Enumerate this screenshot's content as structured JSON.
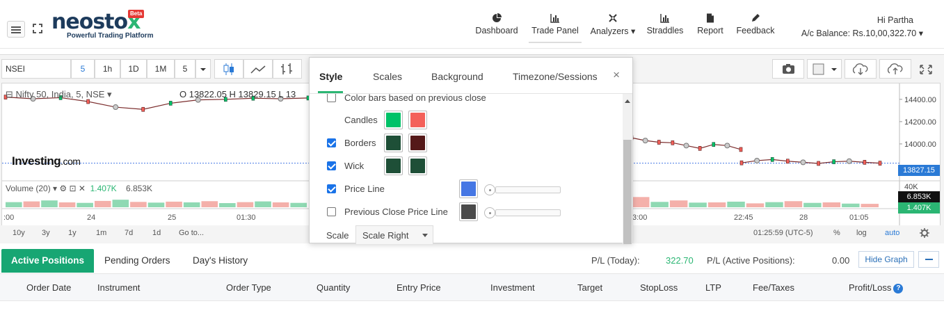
{
  "header": {
    "logo_text": "neosto",
    "logo_x": "x",
    "beta": "Beta",
    "tagline": "Powerful Trading Platform",
    "nav": [
      {
        "label": "Dashboard",
        "icon": "pie-chart-icon"
      },
      {
        "label": "Trade Panel",
        "icon": "bar-chart-icon"
      },
      {
        "label": "Analyzers",
        "icon": "tools-icon"
      },
      {
        "label": "Straddles",
        "icon": "bar-chart-icon"
      },
      {
        "label": "Report",
        "icon": "document-icon"
      },
      {
        "label": "Feedback",
        "icon": "pencil-icon"
      }
    ],
    "greeting": "Hi Partha",
    "balance": "A/c Balance: Rs.10,00,322.70"
  },
  "chart": {
    "symbol": "NSEI",
    "timeframes": [
      "5",
      "1h",
      "1D",
      "1M",
      "5"
    ],
    "legend": "Nifty 50, India, 5, NSE",
    "ohlc": "O 13822.05   H 13829.15   L 13",
    "watermark": "Investing",
    "watermark_suffix": ".com",
    "volume_label": "Volume (20)",
    "volume_1": "1.407K",
    "volume_2": "6.853K",
    "last_price": "13827.15",
    "vol_tag_1": "6.853K",
    "vol_tag_2": "1.407K",
    "bottom": [
      "10y",
      "3y",
      "1y",
      "1m",
      "7d",
      "1d",
      "Go to..."
    ],
    "clock": "01:25:59 (UTC-5)",
    "pct": "%",
    "log": "log",
    "auto": "auto"
  },
  "chart_data": {
    "type": "line",
    "title": "Nifty 50, India, 5, NSE",
    "xlabel": "",
    "ylabel": "",
    "x_ticks": [
      ":00",
      "24",
      "25",
      "01:30",
      "3:00",
      "22:45",
      "28",
      "01:05"
    ],
    "y_ticks": [
      14400.0,
      14200.0,
      14000.0
    ],
    "volume_ticks": [
      "40K"
    ],
    "last_price": 13827.15,
    "ohlc": {
      "open": 13822.05,
      "high": 13829.15
    },
    "series": [
      {
        "values": [
          14420,
          14405,
          14415,
          14380,
          14330,
          14310,
          14365,
          14395,
          14400,
          14410,
          14405,
          14412
        ]
      },
      {
        "values": [
          14055,
          14030,
          14015,
          14010,
          13985,
          13960,
          13995,
          13985,
          13950
        ]
      },
      {
        "values": [
          13830,
          13850,
          13860,
          13845,
          13835,
          13825,
          13840,
          13845,
          13835,
          13827
        ]
      }
    ],
    "volume": [
      2.1,
      2.4,
      2.8,
      2.0,
      1.8,
      2.6,
      3.1,
      2.2,
      1.9,
      2.3,
      2.0,
      2.5,
      1.7,
      2.1,
      2.4,
      2.0,
      1.8,
      4.2,
      2.2,
      2.8,
      1.9,
      2.0,
      2.3,
      1.6,
      2.1,
      2.5,
      1.8,
      2.0,
      1.5,
      1.4
    ],
    "grid": false,
    "legend": "top-left"
  },
  "dialog": {
    "tabs": [
      "Style",
      "Scales",
      "Background",
      "Timezone/Sessions"
    ],
    "close": "×",
    "rows": [
      {
        "label": "Color bars based on previous close",
        "checked": false
      },
      {
        "label": "Candles"
      },
      {
        "label": "Borders",
        "checked": true
      },
      {
        "label": "Wick",
        "checked": true
      },
      {
        "label": "Price Line",
        "checked": true
      },
      {
        "label": "Previous Close Price Line",
        "checked": false
      }
    ],
    "colors": {
      "candle_up": "#00c268",
      "candle_down": "#f4615a",
      "border_up": "#1e4f37",
      "border_down": "#551919",
      "wick_up": "#1e4f37",
      "wick_down": "#1e4f37",
      "price_line": "#4677e4",
      "prev_close": "#4a4a4a"
    },
    "scale_label": "Scale",
    "scale_value": "Scale Right"
  },
  "positions": {
    "tabs": [
      "Active Positions",
      "Pending Orders",
      "Day's History"
    ],
    "pl_today_label": "P/L (Today):",
    "pl_today_value": "322.70",
    "pl_active_label": "P/L (Active Positions):",
    "pl_active_value": "0.00",
    "hide_graph": "Hide Graph",
    "columns": [
      "Order Date",
      "Instrument",
      "Order Type",
      "Quantity",
      "Entry Price",
      "Investment",
      "Target",
      "StopLoss",
      "LTP",
      "Fee/Taxes",
      "Profit/Loss"
    ],
    "help": "?"
  }
}
